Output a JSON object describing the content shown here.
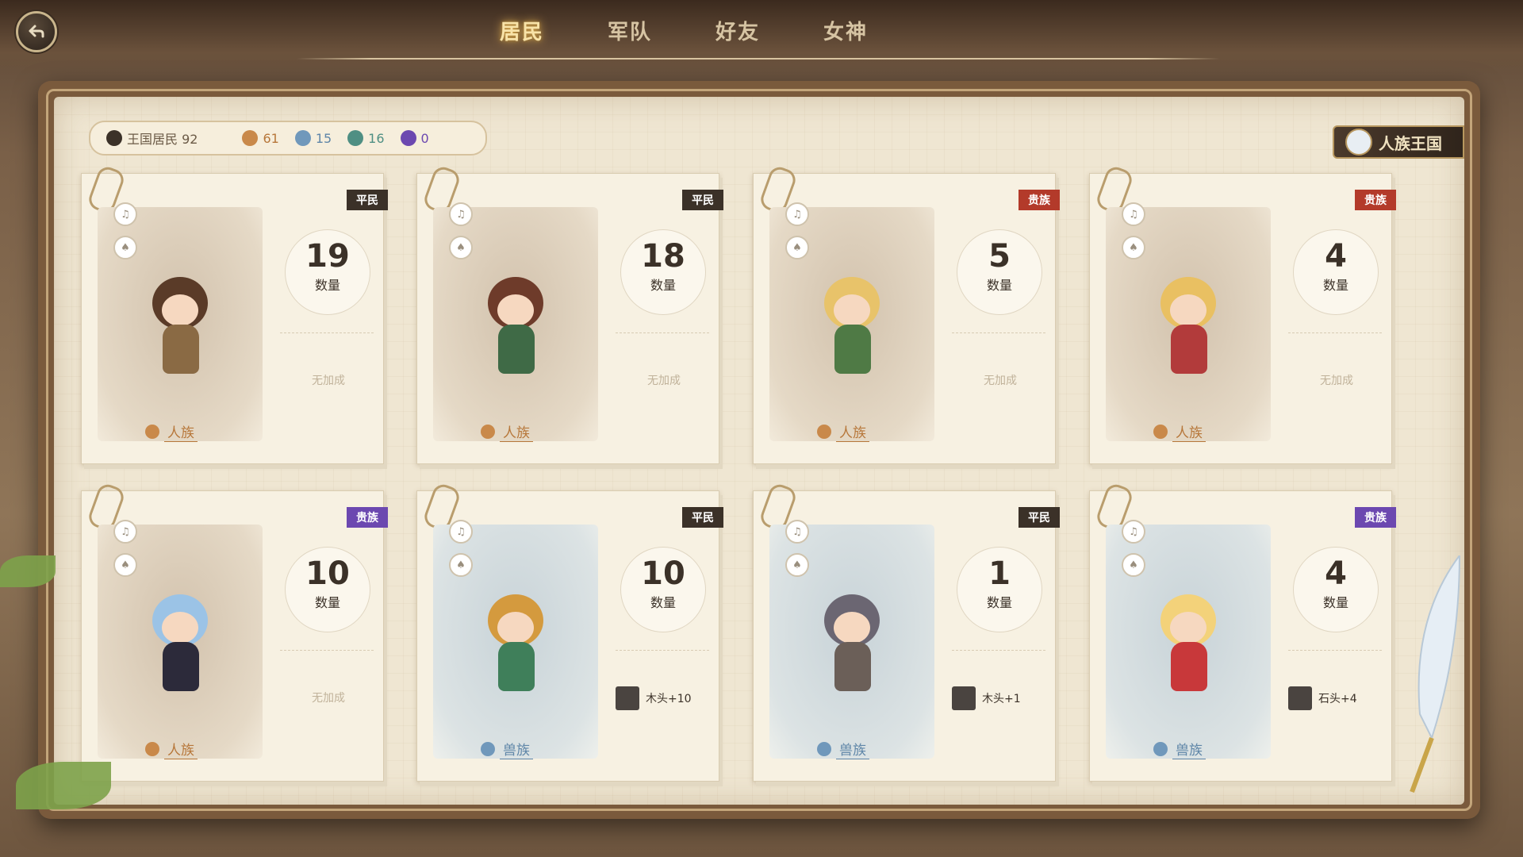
{
  "nav": {
    "back_label": "",
    "tabs": [
      "居民",
      "军队",
      "好友",
      "女神"
    ],
    "active_tab": 0
  },
  "stats": {
    "kingdom_residents": "王国居民 92",
    "human_count": "61",
    "beast_count": "15",
    "green_count": "16",
    "purple_count": "0"
  },
  "kingdom_label": "人族王国",
  "cards": [
    {
      "tag": "平民",
      "tag_type": "civ",
      "count": "19",
      "count_label": "数量",
      "race": "人族",
      "race_type": "human",
      "bonus": "无加成",
      "portrait": "warm"
    },
    {
      "tag": "平民",
      "tag_type": "civ",
      "count": "18",
      "count_label": "数量",
      "race": "人族",
      "race_type": "human",
      "bonus": "无加成",
      "portrait": "warm"
    },
    {
      "tag": "贵族",
      "tag_type": "noble-r",
      "count": "5",
      "count_label": "数量",
      "race": "人族",
      "race_type": "human",
      "bonus": "无加成",
      "portrait": "warm"
    },
    {
      "tag": "贵族",
      "tag_type": "noble-r",
      "count": "4",
      "count_label": "数量",
      "race": "人族",
      "race_type": "human",
      "bonus": "无加成",
      "portrait": "warm"
    },
    {
      "tag": "贵族",
      "tag_type": "noble-p",
      "count": "10",
      "count_label": "数量",
      "race": "人族",
      "race_type": "human",
      "bonus": "无加成",
      "portrait": "warm"
    },
    {
      "tag": "平民",
      "tag_type": "civ",
      "count": "10",
      "count_label": "数量",
      "race": "兽族",
      "race_type": "beast",
      "bonus": "木头+10",
      "portrait": "cool"
    },
    {
      "tag": "平民",
      "tag_type": "civ",
      "count": "1",
      "count_label": "数量",
      "race": "兽族",
      "race_type": "beast",
      "bonus": "木头+1",
      "portrait": "cool"
    },
    {
      "tag": "贵族",
      "tag_type": "noble-p",
      "count": "4",
      "count_label": "数量",
      "race": "兽族",
      "race_type": "beast",
      "bonus": "石头+4",
      "portrait": "cool"
    }
  ],
  "colors": {
    "civ_tag": "#3b3128",
    "noble_red": "#b33a2a",
    "noble_purple": "#6c48b0",
    "human": "#b7773a",
    "beast": "#5f86a8"
  }
}
